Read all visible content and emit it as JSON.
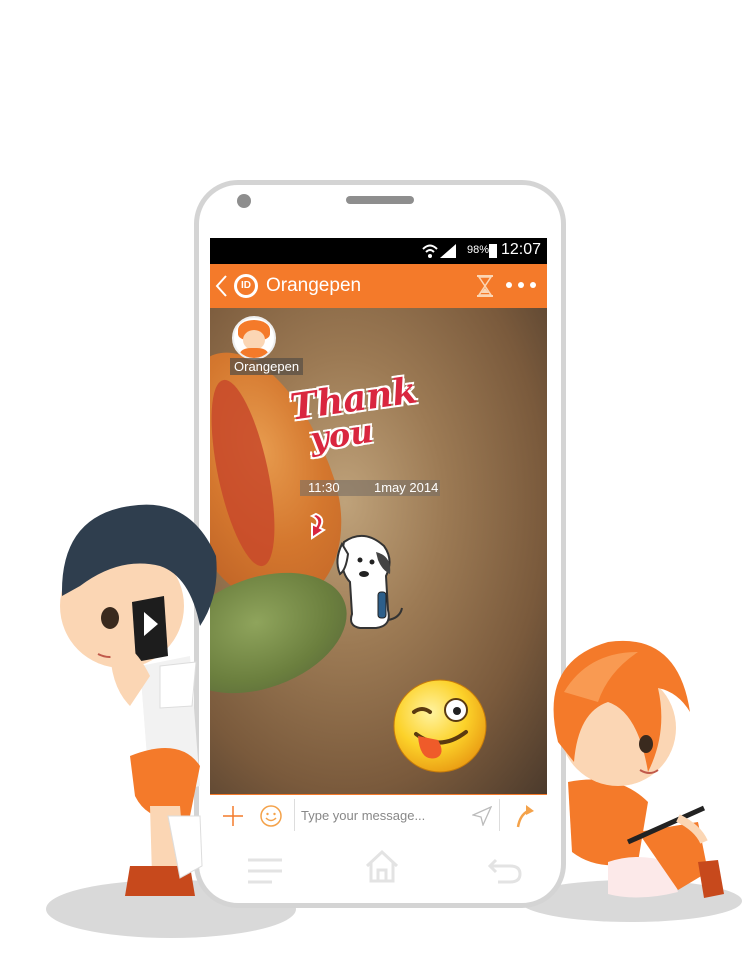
{
  "status_bar": {
    "battery": "98%",
    "time": "12:07"
  },
  "app_bar": {
    "logo_text": "ID",
    "title": "Orangepen"
  },
  "chat": {
    "sender_name": "Orangepen",
    "sticker_text_line1": "Thank",
    "sticker_text_line2": "you",
    "timestamp_time": "11:30",
    "timestamp_date": "1may 2014"
  },
  "input_bar": {
    "placeholder": "Type your message..."
  },
  "colors": {
    "accent": "#f47a2a",
    "sticker_red": "#d9263f"
  }
}
